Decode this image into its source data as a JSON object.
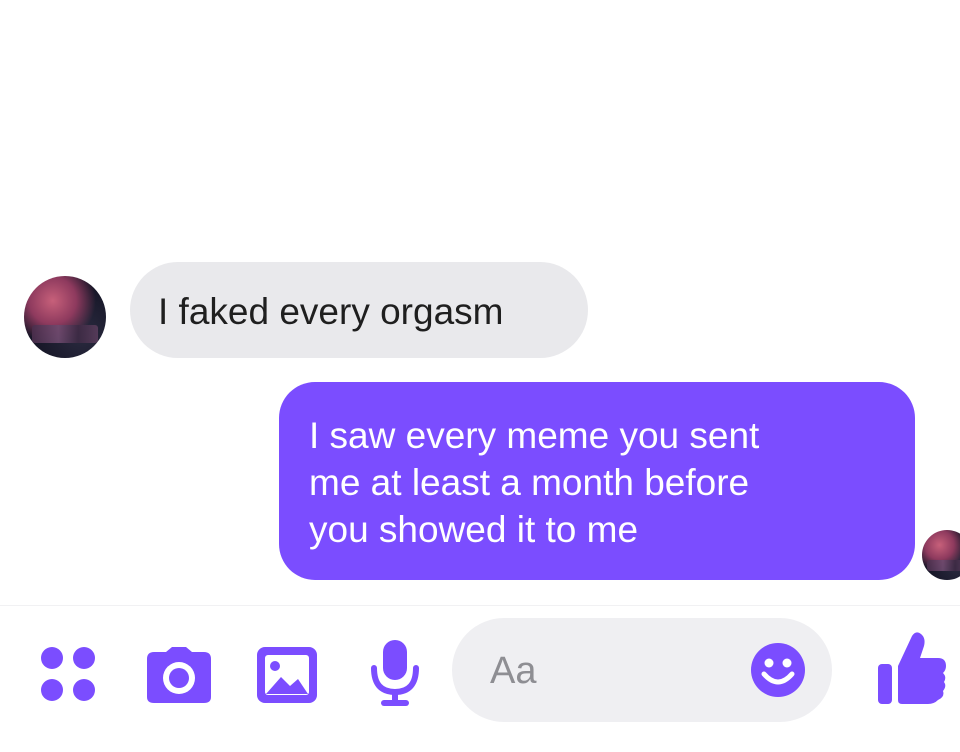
{
  "conversation": {
    "received": {
      "text": "I faked every orgasm"
    },
    "sent": {
      "lines": [
        "I saw every meme you sent",
        "me at least a month before",
        "you showed it to me"
      ]
    }
  },
  "composer": {
    "placeholder": "Aa",
    "icons": {
      "menu": "four-dots-icon",
      "camera": "camera-icon",
      "photo": "image-icon",
      "mic": "microphone-icon",
      "emoji": "smiley-icon",
      "like": "thumbs-up-icon"
    }
  },
  "colors": {
    "accent": "#7b4dff",
    "received_bubble": "#e9e9ec",
    "input_background": "#efeff2",
    "placeholder_text": "#8e8e93"
  }
}
